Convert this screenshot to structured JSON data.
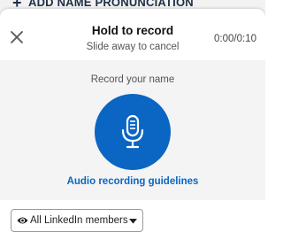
{
  "background_section": {
    "plus_glyph": "+",
    "label": "ADD NAME PRONUNCIATION"
  },
  "header": {
    "title": "Hold to record",
    "subtitle": "Slide away to cancel",
    "timer": "0:00/0:10",
    "close_icon": "close-icon"
  },
  "body": {
    "prompt": "Record your name",
    "mic_icon": "microphone-icon",
    "guidelines_link": "Audio recording guidelines"
  },
  "footer": {
    "visibility_icon": "eye-icon",
    "visibility_selected": "All LinkedIn members",
    "dropdown_icon": "caret-down-icon"
  },
  "colors": {
    "accent": "#0a66c2",
    "panel_bg": "#f4f4f4",
    "text": "#222222"
  }
}
